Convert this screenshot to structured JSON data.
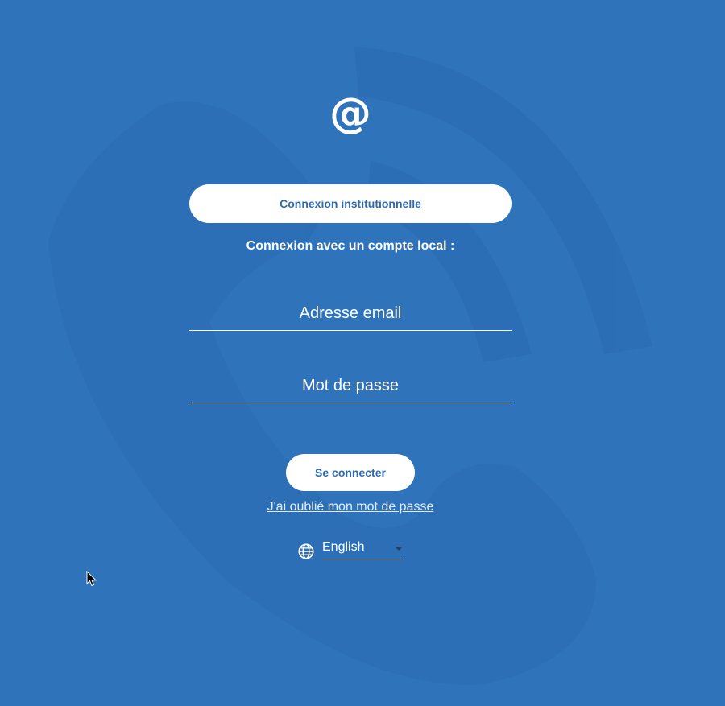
{
  "logo": {
    "symbol": "@",
    "icon": "at-sign-icon"
  },
  "institution_button": {
    "label": "Connexion institutionnelle"
  },
  "local_login": {
    "label": "Connexion avec un compte local :"
  },
  "email_field": {
    "value": "",
    "placeholder": "Adresse email"
  },
  "password_field": {
    "value": "",
    "placeholder": "Mot de passe"
  },
  "login_button": {
    "label": "Se connecter"
  },
  "forgot_password": {
    "label": "J'ai oublié mon mot de passe"
  },
  "language": {
    "selected": "English",
    "icon": "globe-icon"
  },
  "colors": {
    "background": "#2f73bb",
    "button_background": "#ffffff",
    "button_text": "#2f6bb3",
    "text": "#ffffff"
  }
}
